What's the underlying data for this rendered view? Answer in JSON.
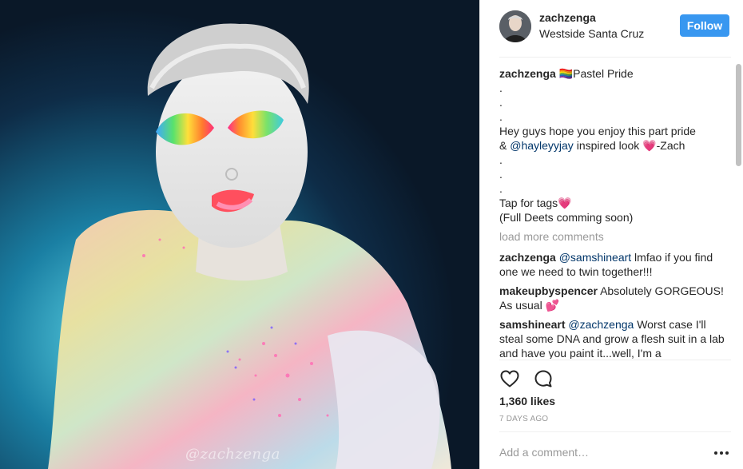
{
  "photo": {
    "watermark": "@zachzenga"
  },
  "header": {
    "username": "zachzenga",
    "location": "Westside Santa Cruz",
    "follow_label": "Follow"
  },
  "caption": {
    "author": "zachzenga",
    "emoji_flags": "🏳️‍🌈",
    "title": "Pastel Pride",
    "dot1": ".",
    "dot2": ".",
    "dot3": ".",
    "line1": "Hey guys hope you enjoy this part pride",
    "line2_prefix": "& ",
    "line2_mention": "@hayleyyjay",
    "line2_suffix": " inspired look 💗-Zach",
    "dot4": ".",
    "dot5": ".",
    "dot6": ".",
    "line3": "Tap for tags💗",
    "line4": "(Full Deets comming soon)"
  },
  "load_more": "load more comments",
  "comments": [
    {
      "author": "zachzenga",
      "mention": "@samshineart",
      "text": " lmfao if you find one we need to twin together!!!"
    },
    {
      "author": "makeupbyspencer",
      "mention": "",
      "text": " Absolutely GORGEOUS! As usual 💕"
    },
    {
      "author": "samshineart",
      "mention": "@zachzenga",
      "text": " Worst case I'll steal some DNA and grow a flesh suit in a lab and have you paint it...well, I'm a"
    }
  ],
  "actions": {
    "like_icon": "heart-icon",
    "comment_icon": "comment-bubble-icon"
  },
  "likes": "1,360 likes",
  "timestamp": "7 DAYS AGO",
  "add_comment_placeholder": "Add a comment…",
  "more_icon": "ellipsis-icon"
}
